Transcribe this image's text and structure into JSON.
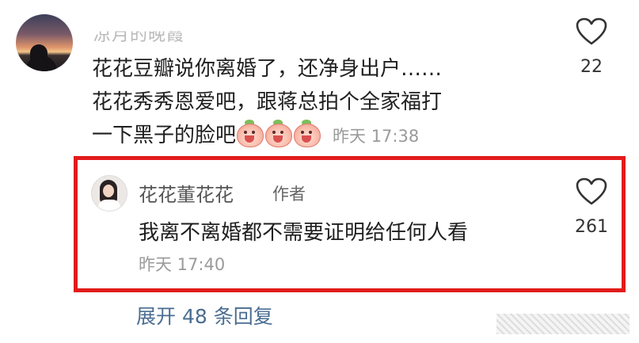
{
  "comment": {
    "username": "凉月的晚霞",
    "text_lines": [
      "花花豆瓣说你离婚了，还净身出户……",
      "花花秀秀恩爱吧，跟蒋总拍个全家福打",
      "一下黑子的脸吧"
    ],
    "emoji_count": 3,
    "time": "昨天 17:38",
    "like_count": "22",
    "like_icon": "heart-outline-icon"
  },
  "reply": {
    "username": "花花董花花",
    "author_tag": "作者",
    "text": "我离不离婚都不需要证明给任何人看",
    "time": "昨天 17:40",
    "like_count": "261",
    "like_icon": "heart-outline-icon",
    "highlight_color": "#e21b1b"
  },
  "expand_replies": "展开 48 条回复",
  "colors": {
    "link": "#4a6d92",
    "timestamp": "#9a9a9a"
  }
}
